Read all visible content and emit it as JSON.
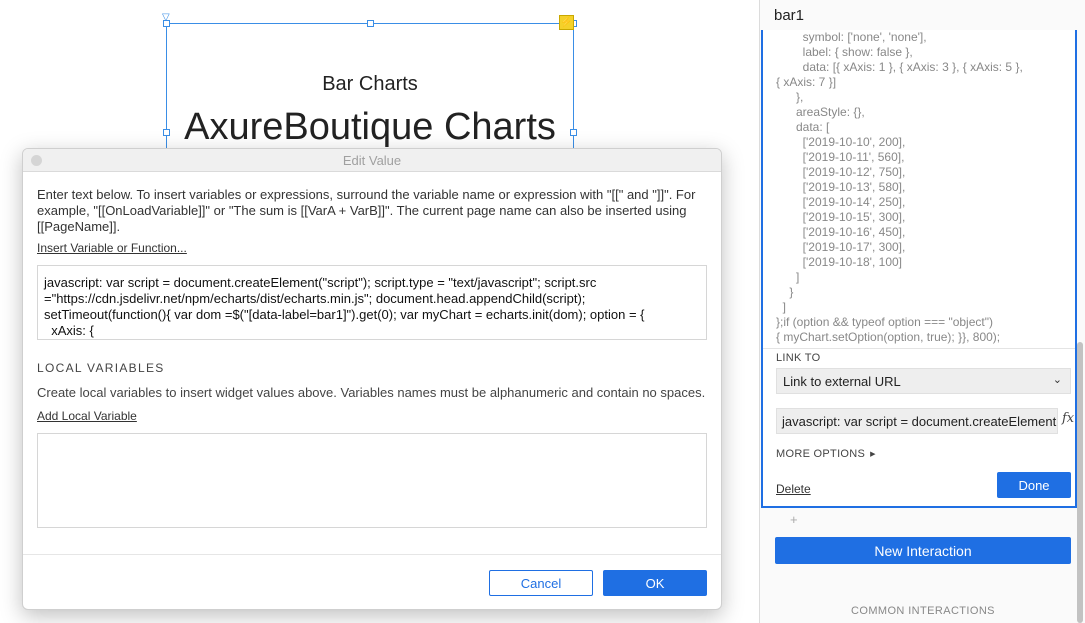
{
  "canvas": {
    "widget_subtitle": "Bar Charts",
    "widget_title": "AxureBoutique Charts",
    "lightning_icon": "lightning-icon"
  },
  "dialog": {
    "title": "Edit Value",
    "instructions": "Enter text below. To insert variables or expressions, surround the variable name or expression with \"[[\" and \"]]\". For example, \"[[OnLoadVariable]]\" or \"The sum is [[VarA + VarB]]\". The current page name can also be inserted using [[PageName]].",
    "insert_link": "Insert Variable or Function...",
    "value_text": "javascript: var script = document.createElement(\"script\"); script.type = \"text/javascript\"; script.src =\"https://cdn.jsdelivr.net/npm/echarts/dist/echarts.min.js\"; document.head.appendChild(script); setTimeout(function(){ var dom =$(\"[data-label=bar1]\").get(0); var myChart = echarts.init(dom); option = {\n  xAxis: {",
    "local_vars_heading": "LOCAL VARIABLES",
    "local_vars_desc": "Create local variables to insert widget values above. Variables names must be alphanumeric and contain no spaces.",
    "add_local_variable": "Add Local Variable",
    "cancel_label": "Cancel",
    "ok_label": "OK"
  },
  "panel": {
    "title": "bar1",
    "code_text": "        symbol: ['none', 'none'],\n        label: { show: false },\n        data: [{ xAxis: 1 }, { xAxis: 3 }, { xAxis: 5 },\n{ xAxis: 7 }]\n      },\n      areaStyle: {},\n      data: [\n        ['2019-10-10', 200],\n        ['2019-10-11', 560],\n        ['2019-10-12', 750],\n        ['2019-10-13', 580],\n        ['2019-10-14', 250],\n        ['2019-10-15', 300],\n        ['2019-10-16', 450],\n        ['2019-10-17', 300],\n        ['2019-10-18', 100]\n      ]\n    }\n  ]\n};if (option && typeof option === \"object\")\n{ myChart.setOption(option, true); }}, 800);",
    "link_to_label": "LINK TO",
    "link_select_value": "Link to external URL",
    "url_value": "javascript: var script = document.createElement(",
    "fx_label": "fx",
    "more_options_label": "MORE OPTIONS",
    "delete_label": "Delete",
    "done_label": "Done",
    "plus_label": "+",
    "new_interaction_label": "New Interaction",
    "common_interactions_label": "COMMON INTERACTIONS"
  }
}
